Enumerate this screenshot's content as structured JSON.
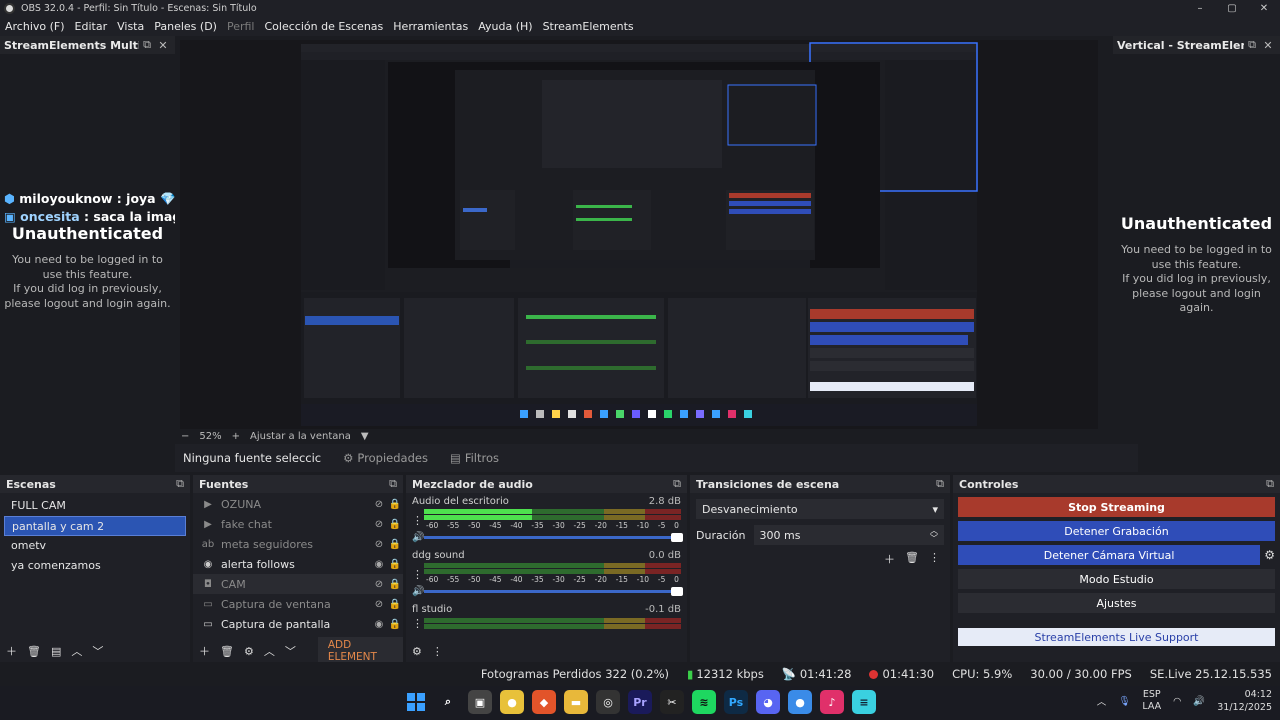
{
  "window": {
    "title": "OBS 32.0.4 - Perfil: Sin Título - Escenas: Sin Título",
    "controls": [
      "–",
      "▢",
      "✕"
    ]
  },
  "menu": [
    "Archivo (F)",
    "Editar",
    "Vista",
    "Paneles (D)",
    "Perfil",
    "Colección de Escenas",
    "Herramientas",
    "Ayuda (H)",
    "StreamElements"
  ],
  "left_dock": {
    "title": "StreamElements Multi-S...",
    "chat": [
      {
        "user": "miloyouknow",
        "text": "joya 💎"
      },
      {
        "user": "oncesita",
        "text": "saca la imagen"
      }
    ],
    "unauth_title": "Unauthenticated",
    "unauth_lines": [
      "You need to be logged in to",
      "use this feature.",
      "If you did log in previously,",
      "please logout and login again."
    ]
  },
  "right_dock": {
    "title": "Vertical - StreamEleme...",
    "unauth_title": "Unauthenticated",
    "unauth_lines": [
      "You need to be logged in to",
      "use this feature.",
      "If you did log in previously,",
      "please logout and login",
      "again."
    ]
  },
  "zoom": {
    "minus": "−",
    "value": "52%",
    "plus": "+",
    "fit": "Ajustar a la ventana"
  },
  "source_bar": {
    "no_source": "Ninguna fuente seleccic",
    "properties": "Propiedades",
    "filters": "Filtros"
  },
  "scenes": {
    "title": "Escenas",
    "items": [
      "FULL CAM",
      "pantalla y cam 2",
      "ometv",
      "ya comenzamos"
    ],
    "selected": "pantalla y cam 2"
  },
  "sources": {
    "title": "Fuentes",
    "items": [
      {
        "label": "OZUNA",
        "icon": "play-icon",
        "visible": false
      },
      {
        "label": "fake chat",
        "icon": "play-icon",
        "visible": false
      },
      {
        "label": "meta seguidores",
        "icon": "text-icon",
        "visible": false
      },
      {
        "label": "alerta follows",
        "icon": "browser-icon",
        "visible": true
      },
      {
        "label": "CAM",
        "icon": "camera-icon",
        "visible": false
      },
      {
        "label": "Captura de ventana",
        "icon": "window-icon",
        "visible": false
      },
      {
        "label": "Captura de pantalla",
        "icon": "monitor-icon",
        "visible": true
      }
    ],
    "add_element": "ADD ELEMENT"
  },
  "mixer": {
    "title": "Mezclador de audio",
    "scale": [
      "-60",
      "-55",
      "-50",
      "-45",
      "-40",
      "-35",
      "-30",
      "-25",
      "-20",
      "-15",
      "-10",
      "-5",
      "0"
    ],
    "channels": [
      {
        "name": "Audio del escritorio",
        "db": "2.8 dB",
        "level": 0.42
      },
      {
        "name": "ddg sound",
        "db": "0.0 dB",
        "level": 0.0
      },
      {
        "name": "fl studio",
        "db": "-0.1 dB",
        "level": 0.0
      }
    ]
  },
  "transitions": {
    "title": "Transiciones de escena",
    "selected": "Desvanecimiento",
    "duration_label": "Duración",
    "duration_value": "300 ms"
  },
  "controls": {
    "title": "Controles",
    "stop_streaming": "Stop Streaming",
    "stop_recording": "Detener Grabación",
    "stop_virtual_cam": "Detener Cámara Virtual",
    "studio_mode": "Modo Estudio",
    "settings": "Ajustes",
    "support": "StreamElements Live Support"
  },
  "status": {
    "dropped": "Fotogramas Perdidos 322 (0.2%)",
    "bitrate": "12312 kbps",
    "stream_time": "01:41:28",
    "rec_time": "01:41:30",
    "cpu": "CPU: 5.9%",
    "fps": "30.00 / 30.00 FPS",
    "version": "SE.Live 25.12.15.535"
  },
  "taskbar": {
    "lang_top": "ESP",
    "lang_bottom": "LAA",
    "time": "04:12",
    "date": "31/12/2025"
  },
  "colors": {
    "accent_blue": "#2f4db8",
    "stream_red": "#a83a2c",
    "selected_scene": "#2b55b3",
    "meter_green": "#4ee04e"
  }
}
